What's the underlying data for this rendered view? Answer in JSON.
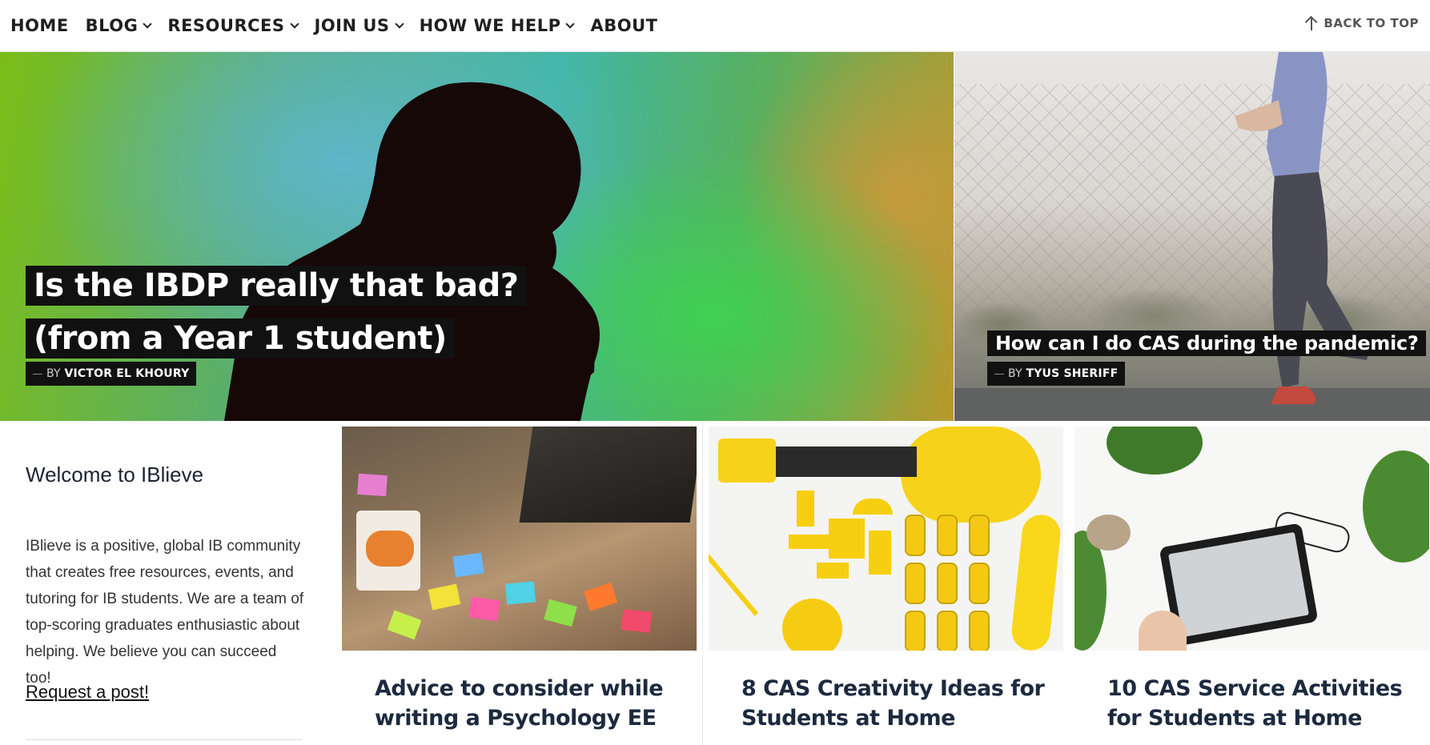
{
  "nav": {
    "items": [
      {
        "label": "HOME",
        "dropdown": false
      },
      {
        "label": "BLOG",
        "dropdown": true
      },
      {
        "label": "RESOURCES",
        "dropdown": true
      },
      {
        "label": "JOIN US",
        "dropdown": true
      },
      {
        "label": "HOW WE HELP",
        "dropdown": true
      },
      {
        "label": "ABOUT",
        "dropdown": false
      }
    ],
    "back_to_top": "BACK TO TOP"
  },
  "hero": {
    "main": {
      "title": "Is the IBDP really that bad? (from a Year 1 student)",
      "byline_prefix": "BY",
      "author": "VICTOR EL KHOURY"
    },
    "side": {
      "title": "How can I do CAS during the pandemic?",
      "byline_prefix": "BY",
      "author": "TYUS SHERIFF"
    }
  },
  "sidebar": {
    "heading": "Welcome to IBlieve",
    "body": "IBlieve is a positive, global IB community that creates free resources, events, and tutoring for IB students. We are a team of top-scoring graduates enthusiastic about helping. We believe you can succeed too!",
    "link": "Request a post!"
  },
  "cards": [
    {
      "title": "Advice to consider while writing a Psychology EE"
    },
    {
      "title": "8 CAS Creativity Ideas for Students at Home"
    },
    {
      "title": "10 CAS Service Activities for Students at Home"
    }
  ],
  "colors": {
    "title_bg": "#111111",
    "title_text": "#ffffff",
    "card_title": "#1c2a3f",
    "nav_text": "#1f1f1f"
  }
}
